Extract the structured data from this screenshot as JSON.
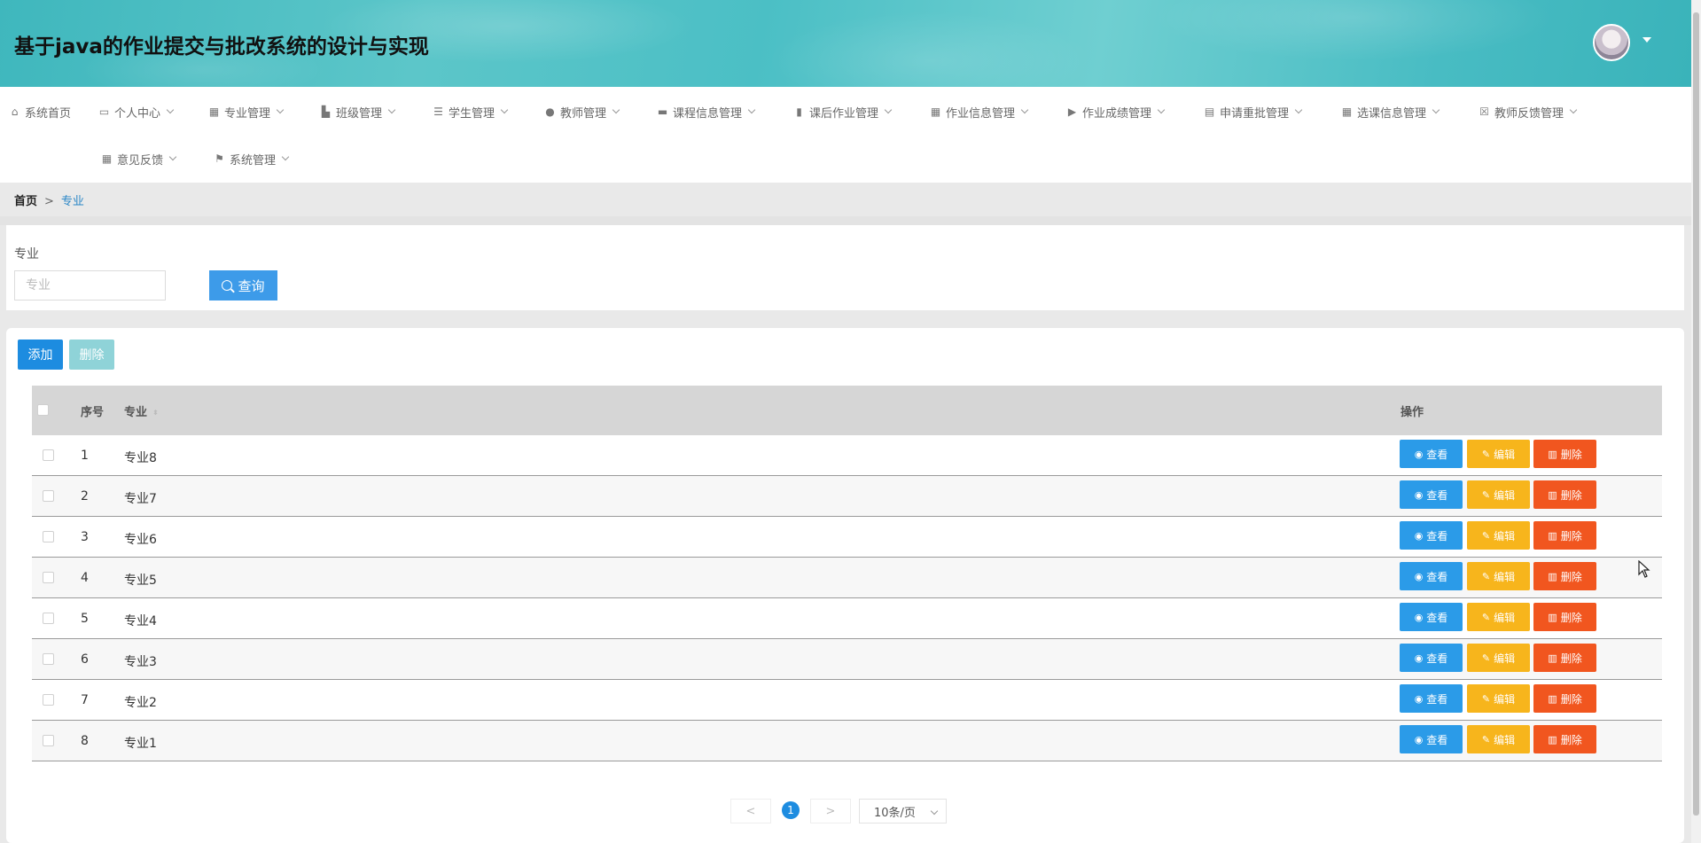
{
  "app": {
    "title": "基于java的作业提交与批改系统的设计与实现"
  },
  "nav": {
    "items": [
      {
        "label": "系统首页",
        "icon": "home-icon",
        "has_dropdown": false
      },
      {
        "label": "个人中心",
        "icon": "window-icon",
        "has_dropdown": true
      },
      {
        "label": "专业管理",
        "icon": "grid-icon",
        "has_dropdown": true
      },
      {
        "label": "班级管理",
        "icon": "thumb-icon",
        "has_dropdown": true
      },
      {
        "label": "学生管理",
        "icon": "list-icon",
        "has_dropdown": true
      },
      {
        "label": "教师管理",
        "icon": "user-icon",
        "has_dropdown": true
      },
      {
        "label": "课程信息管理",
        "icon": "monitor-icon",
        "has_dropdown": true
      },
      {
        "label": "课后作业管理",
        "icon": "bar-chart-icon",
        "has_dropdown": true
      },
      {
        "label": "作业信息管理",
        "icon": "table-icon",
        "has_dropdown": true
      },
      {
        "label": "作业成绩管理",
        "icon": "camera-icon",
        "has_dropdown": true
      },
      {
        "label": "申请重批管理",
        "icon": "printer-icon",
        "has_dropdown": true
      },
      {
        "label": "选课信息管理",
        "icon": "grid-icon",
        "has_dropdown": true
      },
      {
        "label": "教师反馈管理",
        "icon": "clipboard-icon",
        "has_dropdown": true
      },
      {
        "label": "意见反馈",
        "icon": "grid-icon",
        "has_dropdown": true
      },
      {
        "label": "系统管理",
        "icon": "flag-icon",
        "has_dropdown": true
      }
    ]
  },
  "breadcrumb": {
    "home": "首页",
    "separator": ">",
    "current": "专业"
  },
  "search": {
    "label": "专业",
    "placeholder": "专业",
    "button_label": "查询"
  },
  "toolbar": {
    "add_label": "添加",
    "delete_label": "删除"
  },
  "table": {
    "columns": {
      "index": "序号",
      "major": "专业",
      "actions": "操作"
    },
    "rows": [
      {
        "index": "1",
        "major": "专业8"
      },
      {
        "index": "2",
        "major": "专业7"
      },
      {
        "index": "3",
        "major": "专业6"
      },
      {
        "index": "4",
        "major": "专业5"
      },
      {
        "index": "5",
        "major": "专业4"
      },
      {
        "index": "6",
        "major": "专业3"
      },
      {
        "index": "7",
        "major": "专业2"
      },
      {
        "index": "8",
        "major": "专业1"
      }
    ],
    "actions": {
      "view": "查看",
      "edit": "编辑",
      "delete": "删除"
    }
  },
  "pagination": {
    "prev": "<",
    "current_page": "1",
    "next": ">",
    "page_size": "10条/页"
  },
  "colors": {
    "primary": "#1d8ce0",
    "view": "#2b9be8",
    "edit": "#f7b51c",
    "delete": "#f1561f",
    "header": "#4bbfc5"
  }
}
